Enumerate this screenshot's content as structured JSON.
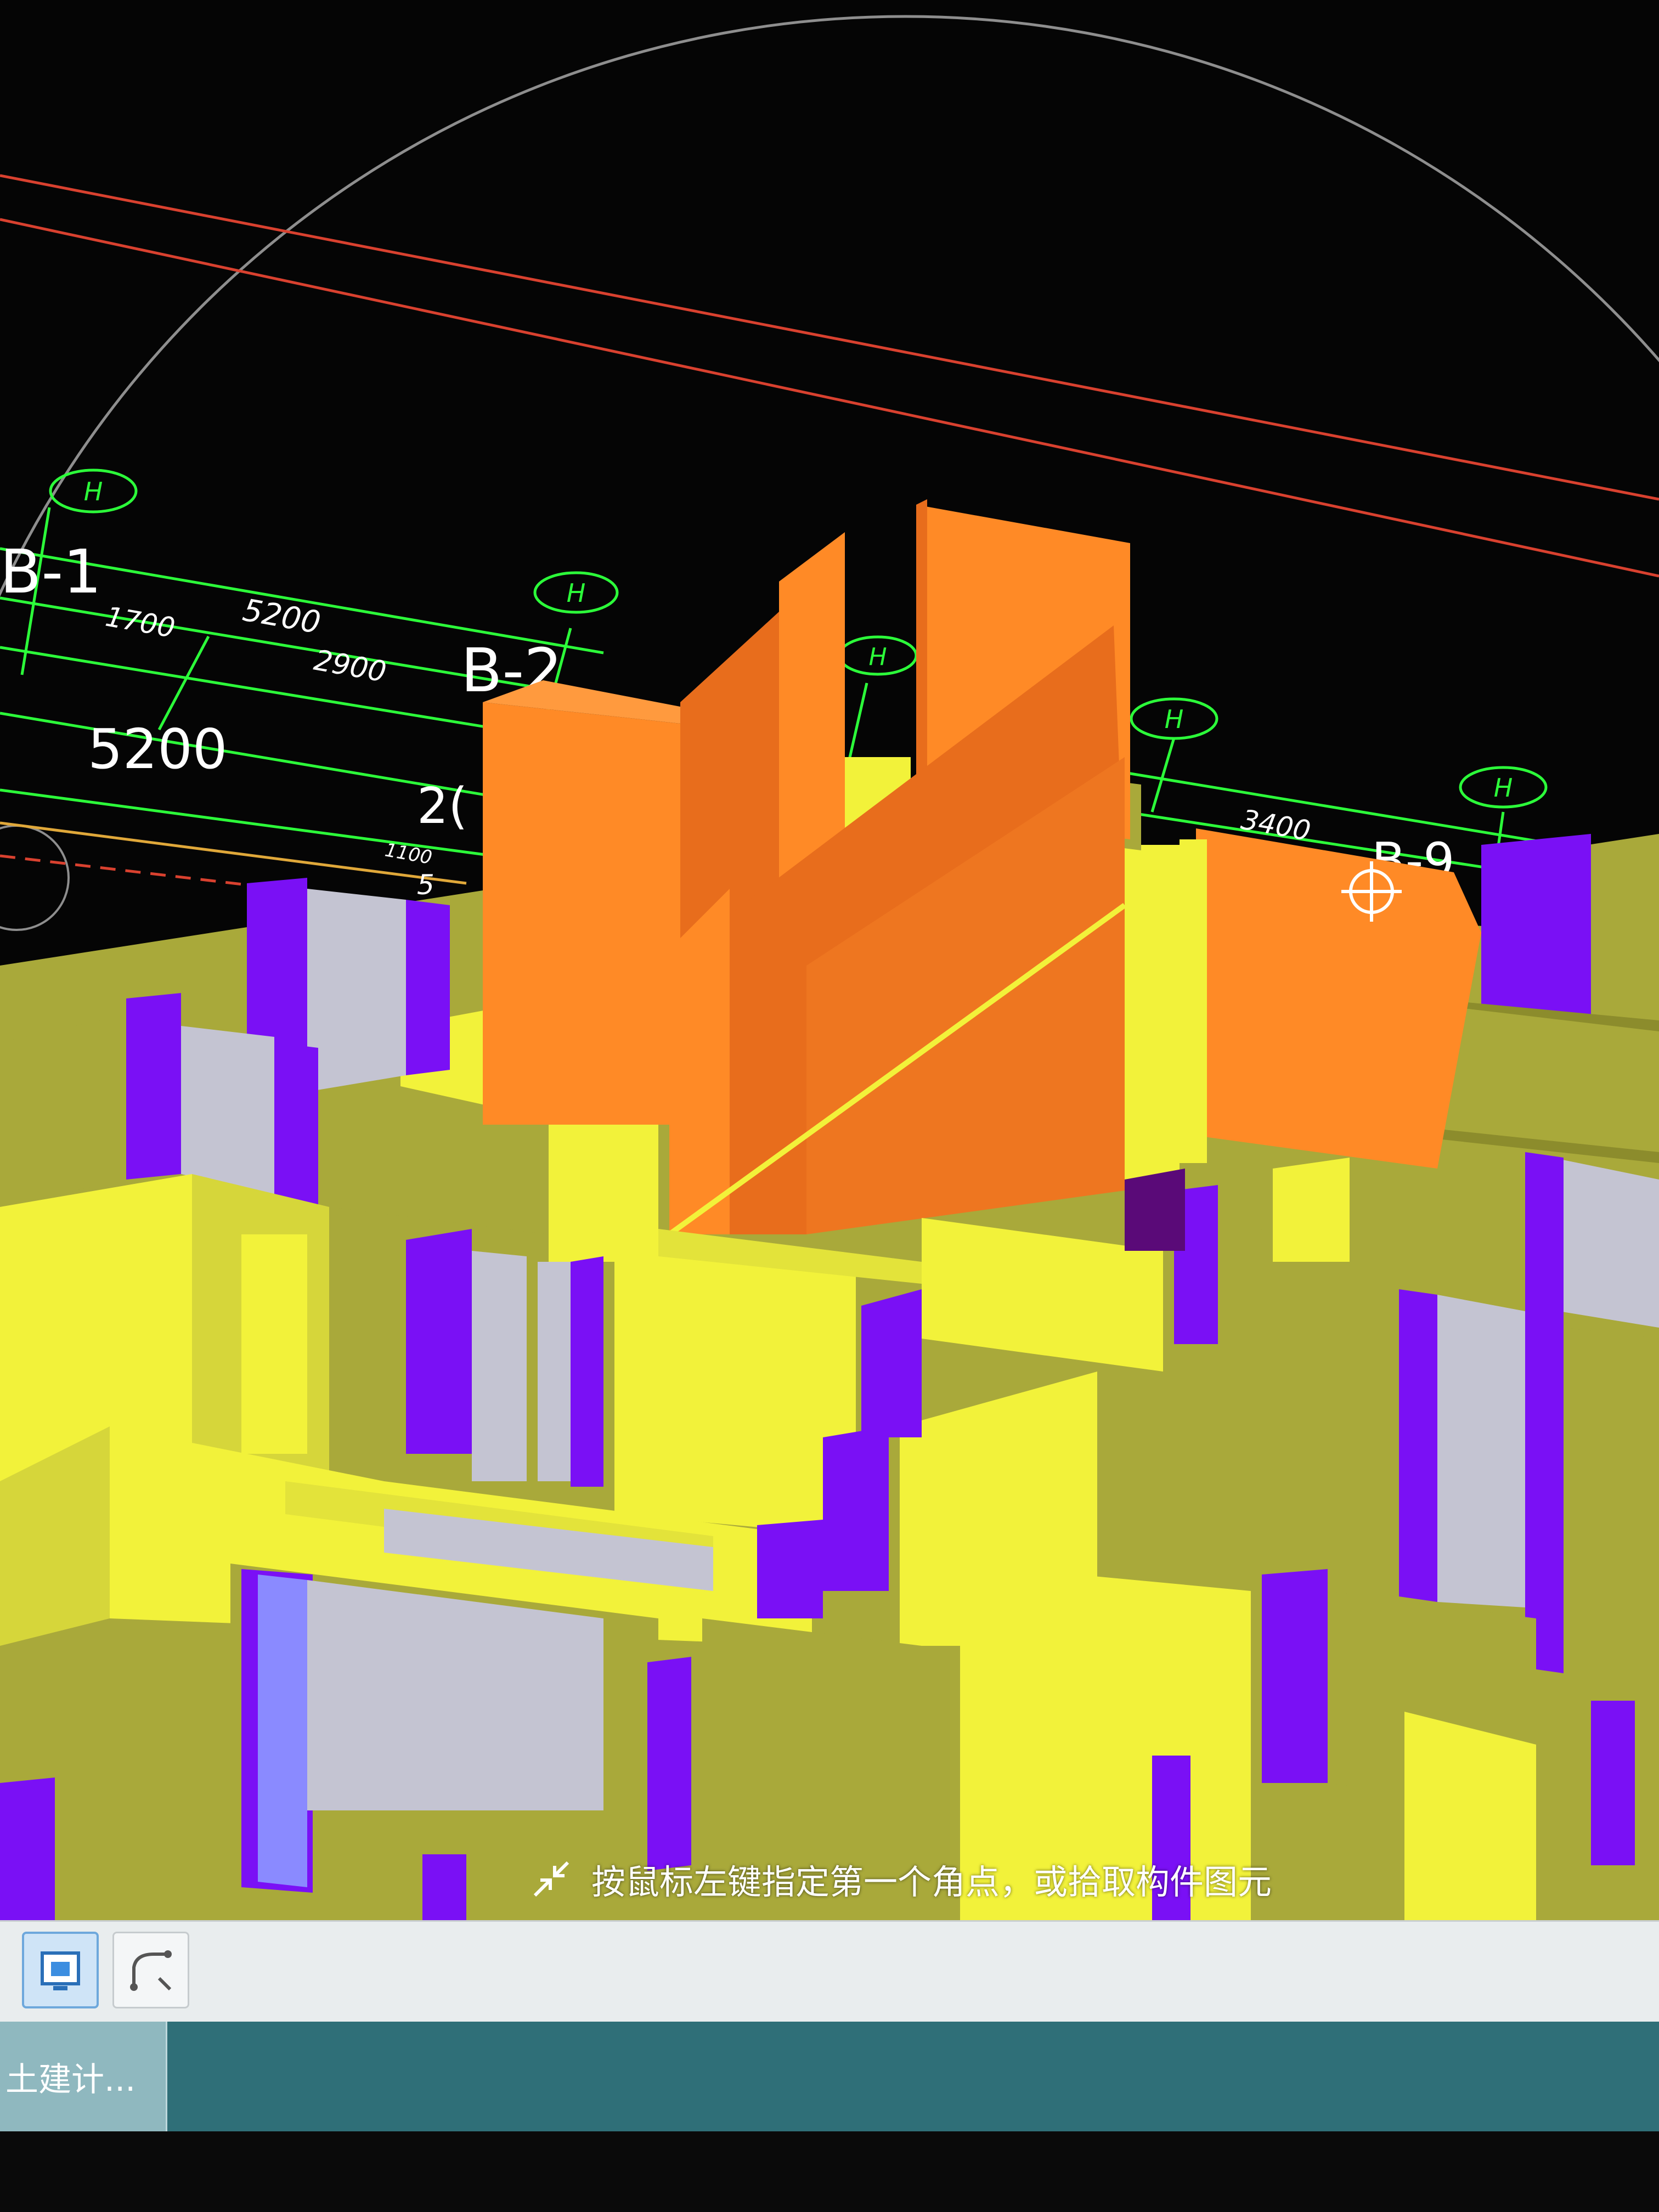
{
  "axis_labels": {
    "b1": "B-1",
    "b2": "B-2",
    "b9": "B-9",
    "partial": "2("
  },
  "dimensions": {
    "d5200_top": "5200",
    "d1700": "1700",
    "d2900": "2900",
    "d5200_big": "5200",
    "d3400": "3400",
    "d1100": "1100",
    "d5": "5"
  },
  "grid_bubbles": {
    "b_h1": "H",
    "b_h2": "H",
    "b_h3": "H",
    "b_h4": "H",
    "b_h5": "H"
  },
  "prompt": {
    "text": "按鼠标左键指定第一个角点，或拾取构件图元"
  },
  "toolbar": {
    "select_tool": "select-rect-icon",
    "curve_tool": "polyline-icon"
  },
  "taskbar": {
    "app_label": "土建计..."
  },
  "colors": {
    "orange_wall": "#ff8a26",
    "yellow_wall": "#f2f23a",
    "olive_wall": "#a9a93a",
    "purple_column": "#7a10f5",
    "grey_face": "#c4c4d2",
    "grid_green": "#2cff3a",
    "axis_red": "#d9412f",
    "taskbar_teal": "#2f6f78"
  }
}
